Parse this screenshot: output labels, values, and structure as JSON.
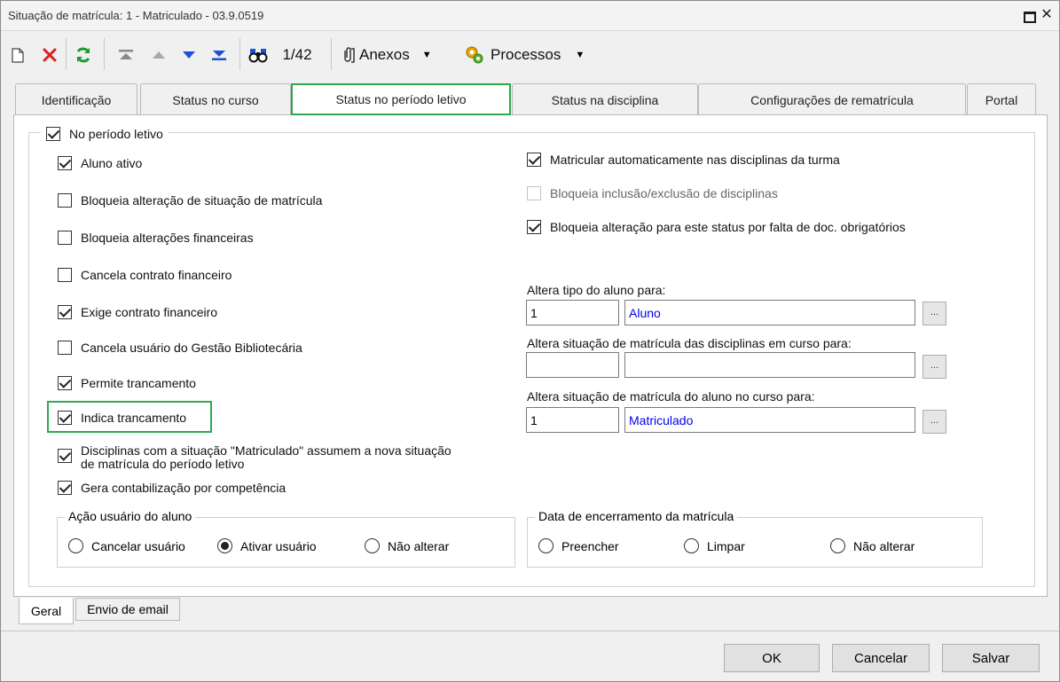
{
  "window": {
    "title": "Situação de matrícula: 1 - Matriculado - 03.9.0519"
  },
  "toolbar": {
    "record_position": "1/42",
    "attachments_label": "Anexos",
    "processes_label": "Processos"
  },
  "tabs": [
    {
      "label": "Identificação"
    },
    {
      "label": "Status no curso"
    },
    {
      "label": "Status no período letivo"
    },
    {
      "label": "Status na disciplina"
    },
    {
      "label": "Configurações de rematrícula"
    },
    {
      "label": "Portal"
    }
  ],
  "group": {
    "label": "No período letivo",
    "checked": true
  },
  "left_options": [
    {
      "label": "Aluno ativo",
      "checked": true
    },
    {
      "label": "Bloqueia alteração de situação de matrícula",
      "checked": false
    },
    {
      "label": "Bloqueia alterações financeiras",
      "checked": false
    },
    {
      "label": "Cancela contrato financeiro",
      "checked": false
    },
    {
      "label": "Exige contrato financeiro",
      "checked": true
    },
    {
      "label": "Cancela usuário do Gestão Bibliotecária",
      "checked": false
    },
    {
      "label": "Permite trancamento",
      "checked": true
    },
    {
      "label": "Indica trancamento",
      "checked": true
    },
    {
      "label": "Disciplinas com a situação \"Matriculado\" assumem a nova situação",
      "label2": "de matrícula do período letivo",
      "checked": true
    },
    {
      "label": "Gera contabilização por competência",
      "checked": true
    }
  ],
  "right_options": [
    {
      "label": "Matricular automaticamente nas disciplinas da turma",
      "checked": true,
      "enabled": true
    },
    {
      "label": "Bloqueia inclusão/exclusão de disciplinas",
      "checked": false,
      "enabled": false
    },
    {
      "label": "Bloqueia alteração para este status por falta de doc. obrigatórios",
      "checked": true,
      "enabled": true
    }
  ],
  "fields": [
    {
      "label": "Altera tipo do aluno para:",
      "code": "1",
      "value": "Aluno"
    },
    {
      "label": "Altera situação de matrícula das disciplinas em curso para:",
      "code": "",
      "value": ""
    },
    {
      "label": "Altera situação de matrícula do aluno no curso para:",
      "code": "1",
      "value": "Matriculado"
    }
  ],
  "lookup_button_label": "...",
  "user_action": {
    "title": "Ação usuário do aluno",
    "options": [
      "Cancelar usuário",
      "Ativar usuário",
      "Não alterar"
    ],
    "selected": "Ativar usuário"
  },
  "enrollment_end": {
    "title": "Data de encerramento da matrícula",
    "options": [
      "Preencher",
      "Limpar",
      "Não alterar"
    ],
    "selected": ""
  },
  "bottom_tabs": [
    {
      "label": "Geral"
    },
    {
      "label": "Envio de email"
    }
  ],
  "buttons": {
    "ok": "OK",
    "cancel": "Cancelar",
    "save": "Salvar"
  },
  "colors": {
    "highlight": "#2fa84f",
    "link_text": "#0000ee",
    "delete_icon": "#e02020",
    "refresh_icon": "#1e9a2a",
    "nav_icon": "#1f4fd6"
  }
}
